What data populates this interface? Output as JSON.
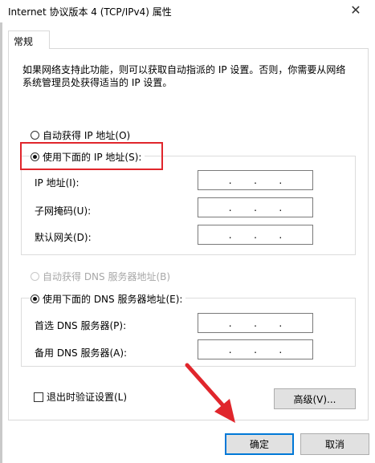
{
  "window": {
    "title": "Internet 协议版本 4 (TCP/IPv4) 属性",
    "close_label": "✕"
  },
  "tabs": [
    {
      "label": "常规"
    }
  ],
  "description": "如果网络支持此功能，则可以获取自动指派的 IP 设置。否则，你需要从网络系统管理员处获得适当的 IP 设置。",
  "ip_section": {
    "auto_radio": {
      "label": "自动获得 IP 地址(O)",
      "checked": false
    },
    "manual_radio": {
      "label": "使用下面的 IP 地址(S):",
      "checked": true
    },
    "fields": [
      {
        "label": "IP 地址(I):",
        "value": ". . ."
      },
      {
        "label": "子网掩码(U):",
        "value": ". . ."
      },
      {
        "label": "默认网关(D):",
        "value": ". . ."
      }
    ]
  },
  "dns_section": {
    "auto_radio": {
      "label": "自动获得 DNS 服务器地址(B)",
      "checked": false,
      "disabled": true
    },
    "manual_radio": {
      "label": "使用下面的 DNS 服务器地址(E):",
      "checked": true
    },
    "fields": [
      {
        "label": "首选 DNS 服务器(P):",
        "value": ". . ."
      },
      {
        "label": "备用 DNS 服务器(A):",
        "value": ". . ."
      }
    ]
  },
  "validate_checkbox": {
    "label": "退出时验证设置(L)",
    "checked": false
  },
  "buttons": {
    "advanced": "高级(V)...",
    "ok": "确定",
    "cancel": "取消"
  },
  "colors": {
    "highlight_box": "#e0262c",
    "arrow": "#e0262c",
    "default_button_border": "#0078d7"
  }
}
